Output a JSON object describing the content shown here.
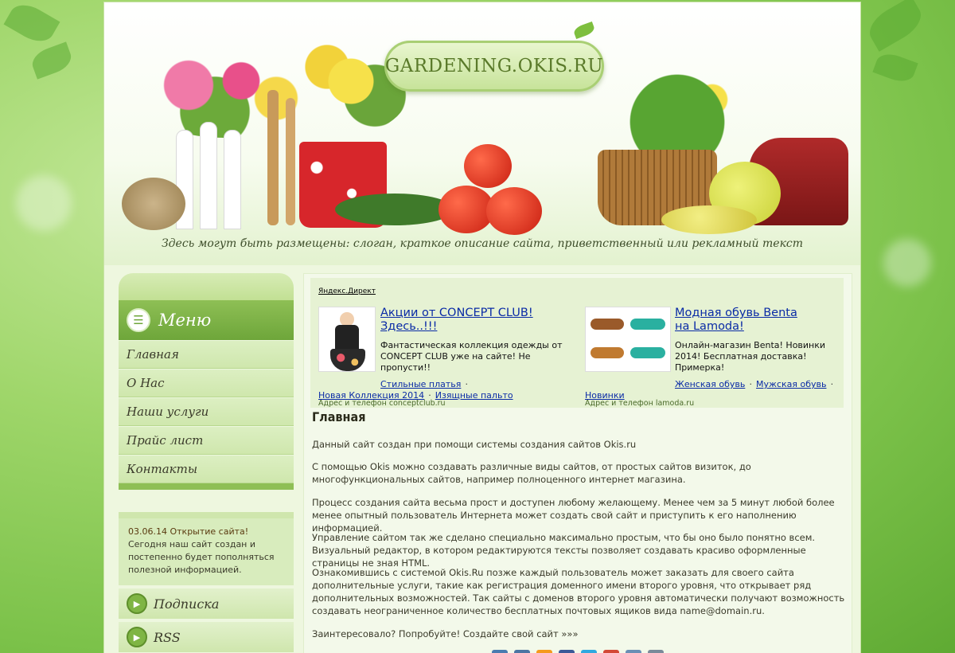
{
  "site": {
    "logo": "GARDENING.OKIS.RU",
    "slogan": "Здесь могут быть размещены: слоган, краткое описание сайта, приветственный или рекламный текст"
  },
  "menu": {
    "title": "Меню",
    "items": [
      "Главная",
      "О Нас",
      "Наши услуги",
      "Прайс лист",
      "Контакты"
    ]
  },
  "news": {
    "date": "03.06.14",
    "title": "Открытие сайта!",
    "text": "Сегодня наш сайт создан и постепенно будет пополняться полезной информацией."
  },
  "side_buttons": [
    "Подписка",
    "RSS"
  ],
  "direct": {
    "label": "Яндекс.Директ",
    "ads": [
      {
        "title": "Акции от CONCEPT CLUB! Здесь..!!!",
        "text": "Фантастическая коллекция одежды от CONCEPT CLUB уже на сайте! Не пропусти!!",
        "links": [
          "Стильные платья",
          "Новая Коллекция 2014",
          "Изящные пальто"
        ],
        "domain": "Адрес и телефон  conceptclub.ru",
        "image": "dress-photo"
      },
      {
        "title": "Модная обувь Benta на Lamoda!",
        "text": "Онлайн-магазин Benta! Новинки 2014! Бесплатная доставка! Примерка!",
        "links": [
          "Женская обувь",
          "Мужская обувь",
          "Новинки"
        ],
        "domain": "Адрес и телефон  lamoda.ru",
        "image": "sandals-photo"
      }
    ]
  },
  "content": {
    "title": "Главная",
    "paragraphs": [
      "Данный сайт создан при помощи системы создания сайтов Okis.ru",
      "С помощью Okis можно создавать различные виды сайтов, от простых сайтов визиток, до многофункциональных сайтов, например полноценного интернет магазина.",
      "Процесс создания сайта весьма прост и доступен любому желающему. Менее чем за 5 минут любой более менее опытный пользователь Интернета может создать свой сайт и приступить к его наполнению информацией.",
      "Управление сайтом так же сделано специально максимально простым, что бы оно было понятно всем. Визуальный редактор, в котором редактируются тексты позволяет создавать красиво оформленные страницы не зная HTML.",
      "Ознакомившись с системой Okis.Ru позже каждый пользователь может заказать для своего сайта дополнительные услуги, такие как регистрация доменного имени второго уровня, что открывает ряд дополнительных возможностей. Так сайты с доменов второго уровня автоматически получают возможность создавать неограниченное количество бесплатных почтовых ящиков вида name@domain.ru.",
      "Заинтересовало? Попробуйте! Создайте свой сайт »»»"
    ]
  },
  "social_icons": [
    {
      "name": "blog-icon",
      "color": "#4a7bb0"
    },
    {
      "name": "vk-icon",
      "color": "#4c75a3"
    },
    {
      "name": "odnoklassniki-icon",
      "color": "#f59a1d"
    },
    {
      "name": "facebook-icon",
      "color": "#3b5998"
    },
    {
      "name": "twitter-icon",
      "color": "#2fa9e0"
    },
    {
      "name": "google-plus-icon",
      "color": "#d34836"
    },
    {
      "name": "mail-icon",
      "color": "#6a8fb5"
    },
    {
      "name": "bookmark-icon",
      "color": "#7a8a9a"
    }
  ]
}
